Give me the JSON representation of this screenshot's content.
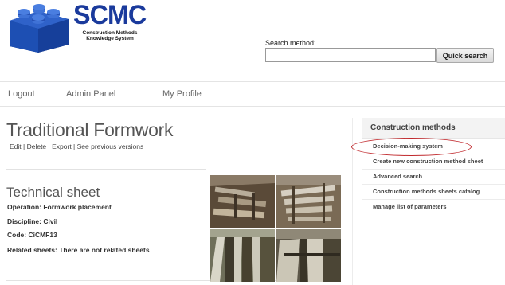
{
  "brand": {
    "title": "SCMC",
    "subtitle_line1": "Construction Methods",
    "subtitle_line2": "Knowledge System",
    "colors": {
      "brick": "#1d4fb3",
      "brick_dark": "#0e2f78",
      "title": "#1a3a9c"
    }
  },
  "search": {
    "label": "Search method:",
    "value": "",
    "placeholder": "",
    "button_label": "Quick search"
  },
  "nav": {
    "items": [
      "Logout",
      "Admin Panel",
      "My Profile"
    ]
  },
  "page": {
    "title": "Traditional Formwork",
    "actions": [
      "Edit",
      "Delete",
      "Export",
      "See previous versions"
    ],
    "actions_separator": " | "
  },
  "sheet": {
    "section_title": "Technical sheet",
    "fields": [
      "Operation: Formwork placement",
      "Discipline: Civil",
      "Code: CiCMF13",
      "Related sheets: There are not related sheets"
    ]
  },
  "photos": {
    "icons": [
      "formwork-photo-1",
      "formwork-photo-2",
      "formwork-photo-3",
      "formwork-photo-4"
    ]
  },
  "sidebar": {
    "title": "Construction methods",
    "items": [
      "Decision-making system",
      "Create new construction method sheet",
      "Advanced search",
      "Construction methods sheets catalog",
      "Manage list of parameters"
    ],
    "highlight_color": "#c0282c"
  }
}
